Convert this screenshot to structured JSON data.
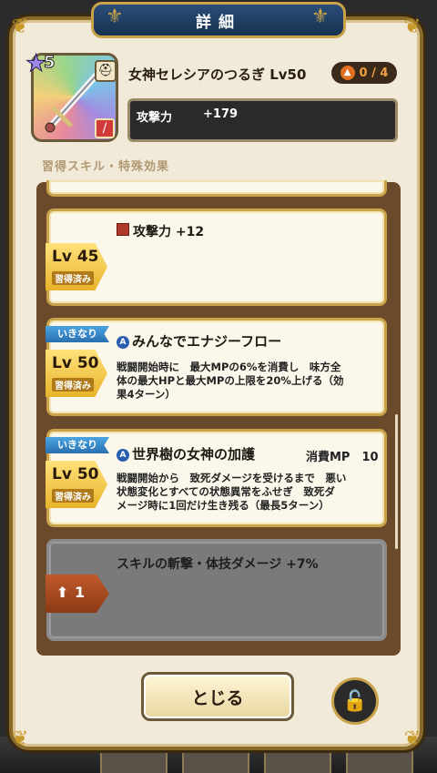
{
  "dialog": {
    "title": "詳細"
  },
  "item": {
    "rarity": "5",
    "name": "女神セレシアのつるぎ Lv50",
    "limit_break": "0 / 4",
    "stat_label": "攻撃力",
    "stat_value": "+179",
    "type_icon": "helmet-icon",
    "weapon_type_icon": "sword-type-icon"
  },
  "section_label": "習得スキル・特殊効果",
  "skills": [
    {
      "level": "Lv 45",
      "learned": "習得済み",
      "text": "攻撃力 +12"
    },
    {
      "sudden": "いきなり",
      "level": "Lv 50",
      "learned": "習得済み",
      "title": "みんなでエナジーフロー",
      "desc": [
        "戦闘開始時に　最大MPの6%を消費し　味方全",
        "体の最大HPと最大MPの上限を20%上げる（効",
        "果4ターン）"
      ]
    },
    {
      "sudden": "いきなり",
      "level": "Lv 50",
      "learned": "習得済み",
      "title": "世界樹の女神の加護",
      "mp": "消費MP　10",
      "desc": [
        "戦闘開始から　致死ダメージを受けるまで　悪い",
        "状態変化とすべての状態異常をふせぎ　致死ダ",
        "メージ時に1回だけ生き残る（最長5ターン）"
      ]
    },
    {
      "locked": true,
      "upgrade": "1",
      "text": "スキルの斬撃・体技ダメージ +7%"
    }
  ],
  "buttons": {
    "close": "とじる"
  },
  "colors": {
    "frame_gold": "#c9a24a",
    "banner_blue": "#1f3d63",
    "panel_bg": "#f2ead8"
  }
}
